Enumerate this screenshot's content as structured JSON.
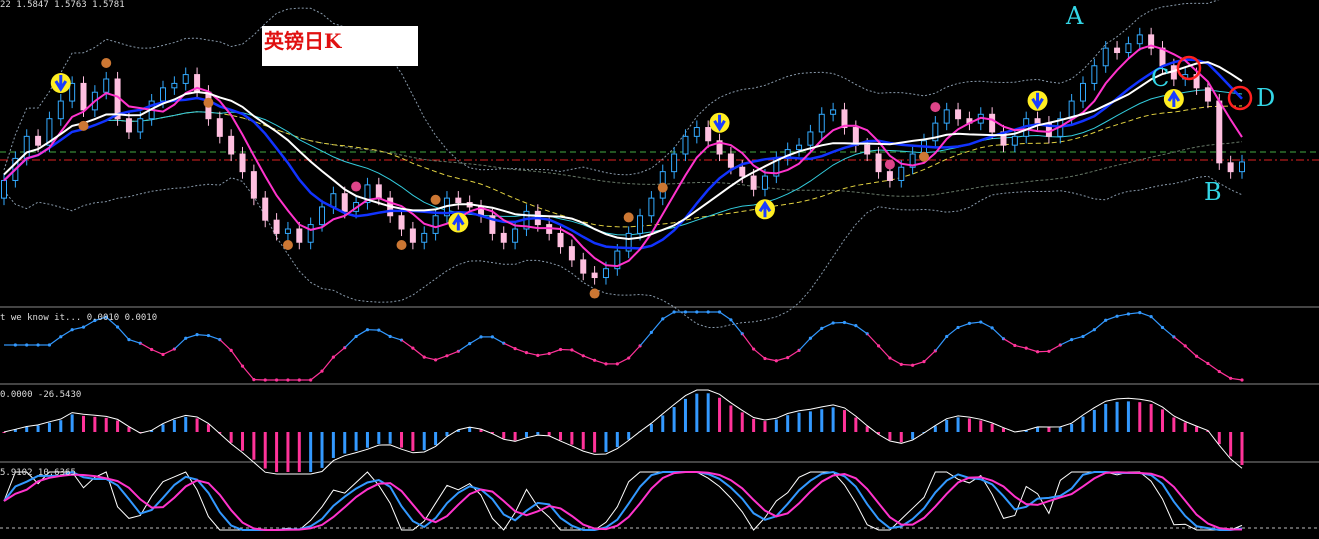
{
  "colors": {
    "background": "#000000",
    "bull_candle": "#33aaff",
    "bear_candle": "#ffc0e0",
    "white_ma": "#ffffff",
    "magenta_ma": "#ff33cc",
    "blue_ma": "#1133ff",
    "cyan_ma": "#33ccdd",
    "yellow_ma": "#e0d040",
    "band": "#8899aa",
    "hist_up": "#3399ff",
    "hist_down": "#ff3399",
    "marker_yellow": "#ffee22",
    "circle_red": "#ff2020",
    "letter_cyan": "#33d6e6"
  },
  "header": {
    "price_text": "22 1.5847 1.5763 1.5781"
  },
  "title_box": {
    "text": "英镑日K"
  },
  "panels": {
    "p1_label": "t we know it... 0.0010 0.0010",
    "p2_label": "0.0000 -26.5430",
    "p3_label": "5.9102 10.6365"
  },
  "markers": {
    "A": "A",
    "B": "B",
    "C": "C",
    "D": "D"
  },
  "chart_data": [
    {
      "type": "candlestick",
      "note_symbol": "英镑日K",
      "close": [
        1.576,
        1.5785,
        1.581,
        1.58,
        1.583,
        1.585,
        1.587,
        1.584,
        1.586,
        1.5875,
        1.583,
        1.5815,
        1.583,
        1.585,
        1.5865,
        1.587,
        1.588,
        1.586,
        1.583,
        1.581,
        1.579,
        1.577,
        1.574,
        1.5715,
        1.57,
        1.5705,
        1.569,
        1.571,
        1.573,
        1.5745,
        1.5725,
        1.5735,
        1.5755,
        1.574,
        1.572,
        1.5705,
        1.569,
        1.57,
        1.572,
        1.574,
        1.5735,
        1.573,
        1.572,
        1.57,
        1.569,
        1.5705,
        1.5725,
        1.571,
        1.57,
        1.5685,
        1.567,
        1.5655,
        1.565,
        1.566,
        1.568,
        1.57,
        1.572,
        1.574,
        1.577,
        1.579,
        1.581,
        1.582,
        1.5805,
        1.579,
        1.5775,
        1.5765,
        1.575,
        1.5765,
        1.5785,
        1.5795,
        1.58,
        1.5815,
        1.5835,
        1.584,
        1.582,
        1.58,
        1.579,
        1.577,
        1.576,
        1.5775,
        1.579,
        1.5805,
        1.5825,
        1.584,
        1.583,
        1.5825,
        1.5835,
        1.5815,
        1.58,
        1.581,
        1.583,
        1.5825,
        1.581,
        1.583,
        1.585,
        1.587,
        1.589,
        1.591,
        1.5905,
        1.5915,
        1.5925,
        1.591,
        1.589,
        1.5875,
        1.588,
        1.5865,
        1.585,
        1.578,
        1.577,
        1.5781
      ],
      "open": [
        1.574,
        1.576,
        1.5785,
        1.581,
        1.58,
        1.583,
        1.585,
        1.587,
        1.584,
        1.586,
        1.5875,
        1.583,
        1.5815,
        1.583,
        1.585,
        1.5865,
        1.587,
        1.588,
        1.586,
        1.583,
        1.581,
        1.579,
        1.577,
        1.574,
        1.5715,
        1.57,
        1.5705,
        1.569,
        1.571,
        1.573,
        1.5745,
        1.5725,
        1.5735,
        1.5755,
        1.574,
        1.572,
        1.5705,
        1.569,
        1.57,
        1.572,
        1.574,
        1.5735,
        1.573,
        1.572,
        1.57,
        1.569,
        1.5705,
        1.5725,
        1.571,
        1.57,
        1.5685,
        1.567,
        1.5655,
        1.565,
        1.566,
        1.568,
        1.57,
        1.572,
        1.574,
        1.577,
        1.579,
        1.581,
        1.582,
        1.5805,
        1.579,
        1.5775,
        1.5765,
        1.575,
        1.5765,
        1.5785,
        1.5795,
        1.58,
        1.5815,
        1.5835,
        1.584,
        1.582,
        1.58,
        1.579,
        1.577,
        1.576,
        1.5775,
        1.579,
        1.5805,
        1.5825,
        1.584,
        1.583,
        1.5825,
        1.5835,
        1.5815,
        1.58,
        1.581,
        1.583,
        1.5825,
        1.581,
        1.583,
        1.585,
        1.587,
        1.589,
        1.591,
        1.5905,
        1.5915,
        1.5925,
        1.591,
        1.589,
        1.5875,
        1.588,
        1.5865,
        1.585,
        1.578,
        1.577
      ],
      "ylim": [
        1.562,
        1.596
      ]
    }
  ]
}
